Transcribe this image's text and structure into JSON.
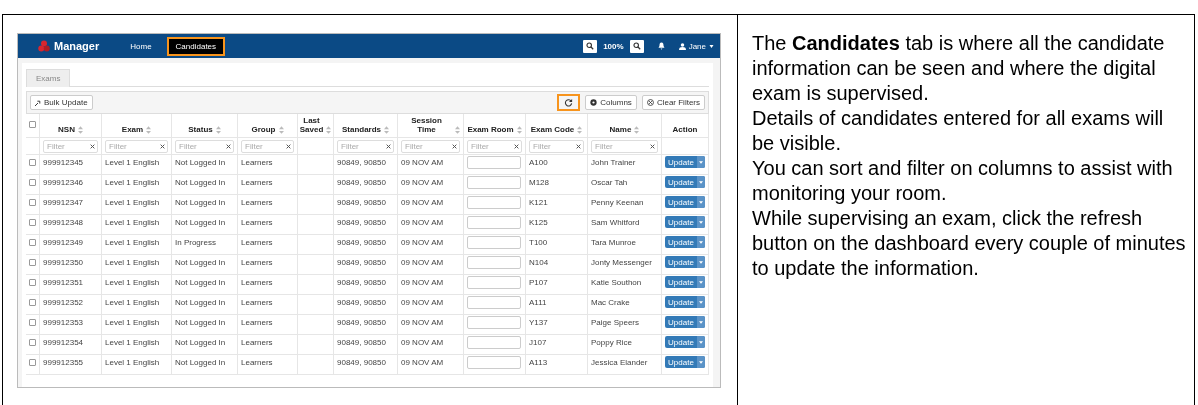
{
  "screenshot": {
    "app_title": "Manager",
    "nav": [
      {
        "label": "Home",
        "selected": false,
        "highlighted": false
      },
      {
        "label": "Candidates",
        "selected": true,
        "highlighted": true
      }
    ],
    "zoom": "100%",
    "user": "Jane",
    "tabs": [
      {
        "label": "Exams",
        "selected": true
      }
    ],
    "toolbar": {
      "bulk_update": "Bulk Update",
      "refresh_highlighted": true,
      "columns": "Columns",
      "clear_filters": "Clear Filters"
    },
    "select_all_checked": false,
    "columns": [
      {
        "label": "NSN",
        "sortable": true,
        "placeholder": "Filter"
      },
      {
        "label": "Exam",
        "sortable": true,
        "placeholder": "Filter"
      },
      {
        "label": "Status",
        "sortable": true,
        "placeholder": "Filter"
      },
      {
        "label": "Group",
        "sortable": true,
        "placeholder": "Filter"
      },
      {
        "label": "Last Saved",
        "sortable": true
      },
      {
        "label": "Standards",
        "sortable": true,
        "placeholder": "Filter"
      },
      {
        "label": "Session Time",
        "sortable": true,
        "placeholder": "Filter"
      },
      {
        "label": "Exam Room",
        "sortable": true,
        "placeholder": "Filter"
      },
      {
        "label": "Exam Code",
        "sortable": true,
        "placeholder": "Filter"
      },
      {
        "label": "Name",
        "sortable": true,
        "placeholder": "Filter"
      },
      {
        "label": "Action",
        "sortable": false
      }
    ],
    "rows": [
      {
        "checked": false,
        "nsn": "999912345",
        "exam": "Level 1 English",
        "status": "Not Logged In",
        "group": "Learners",
        "standards": "90849, 90850",
        "session_time": "09 NOV AM",
        "exam_code": "A100",
        "name": "John Trainer",
        "action": "Update"
      },
      {
        "checked": false,
        "nsn": "999912346",
        "exam": "Level 1 English",
        "status": "Not Logged In",
        "group": "Learners",
        "standards": "90849, 90850",
        "session_time": "09 NOV AM",
        "exam_code": "M128",
        "name": "Oscar Tah",
        "action": "Update"
      },
      {
        "checked": false,
        "nsn": "999912347",
        "exam": "Level 1 English",
        "status": "Not Logged In",
        "group": "Learners",
        "standards": "90849, 90850",
        "session_time": "09 NOV AM",
        "exam_code": "K121",
        "name": "Penny Keenan",
        "action": "Update"
      },
      {
        "checked": false,
        "nsn": "999912348",
        "exam": "Level 1 English",
        "status": "Not Logged In",
        "group": "Learners",
        "standards": "90849, 90850",
        "session_time": "09 NOV AM",
        "exam_code": "K125",
        "name": "Sam Whitford",
        "action": "Update"
      },
      {
        "checked": false,
        "nsn": "999912349",
        "exam": "Level 1 English",
        "status": "In Progress",
        "group": "Learners",
        "standards": "90849, 90850",
        "session_time": "09 NOV AM",
        "exam_code": "T100",
        "name": "Tara Munroe",
        "action": "Update"
      },
      {
        "checked": false,
        "nsn": "999912350",
        "exam": "Level 1 English",
        "status": "Not Logged In",
        "group": "Learners",
        "standards": "90849, 90850",
        "session_time": "09 NOV AM",
        "exam_code": "N104",
        "name": "Jonty Messenger",
        "action": "Update"
      },
      {
        "checked": false,
        "nsn": "999912351",
        "exam": "Level 1 English",
        "status": "Not Logged In",
        "group": "Learners",
        "standards": "90849, 90850",
        "session_time": "09 NOV AM",
        "exam_code": "P107",
        "name": "Katie Southon",
        "action": "Update"
      },
      {
        "checked": false,
        "nsn": "999912352",
        "exam": "Level 1 English",
        "status": "Not Logged In",
        "group": "Learners",
        "standards": "90849, 90850",
        "session_time": "09 NOV AM",
        "exam_code": "A111",
        "name": "Mac Crake",
        "action": "Update"
      },
      {
        "checked": false,
        "nsn": "999912353",
        "exam": "Level 1 English",
        "status": "Not Logged In",
        "group": "Learners",
        "standards": "90849, 90850",
        "session_time": "09 NOV AM",
        "exam_code": "Y137",
        "name": "Paige Speers",
        "action": "Update"
      },
      {
        "checked": false,
        "nsn": "999912354",
        "exam": "Level 1 English",
        "status": "Not Logged In",
        "group": "Learners",
        "standards": "90849, 90850",
        "session_time": "09 NOV AM",
        "exam_code": "J107",
        "name": "Poppy Rice",
        "action": "Update"
      },
      {
        "checked": false,
        "nsn": "999912355",
        "exam": "Level 1 English",
        "status": "Not Logged In",
        "group": "Learners",
        "standards": "90849, 90850",
        "session_time": "09 NOV AM",
        "exam_code": "A113",
        "name": "Jessica Elander",
        "action": "Update"
      }
    ]
  },
  "description": [
    "The **Candidates** tab is where all the candidate information can be seen and where the digital exam is supervised.",
    "Details of candidates entered for all exams will be visible.",
    "You can sort and filter on columns to assist with monitoring your room.",
    "While supervising an exam, click the refresh button on the dashboard every couple of minutes to update the information."
  ]
}
